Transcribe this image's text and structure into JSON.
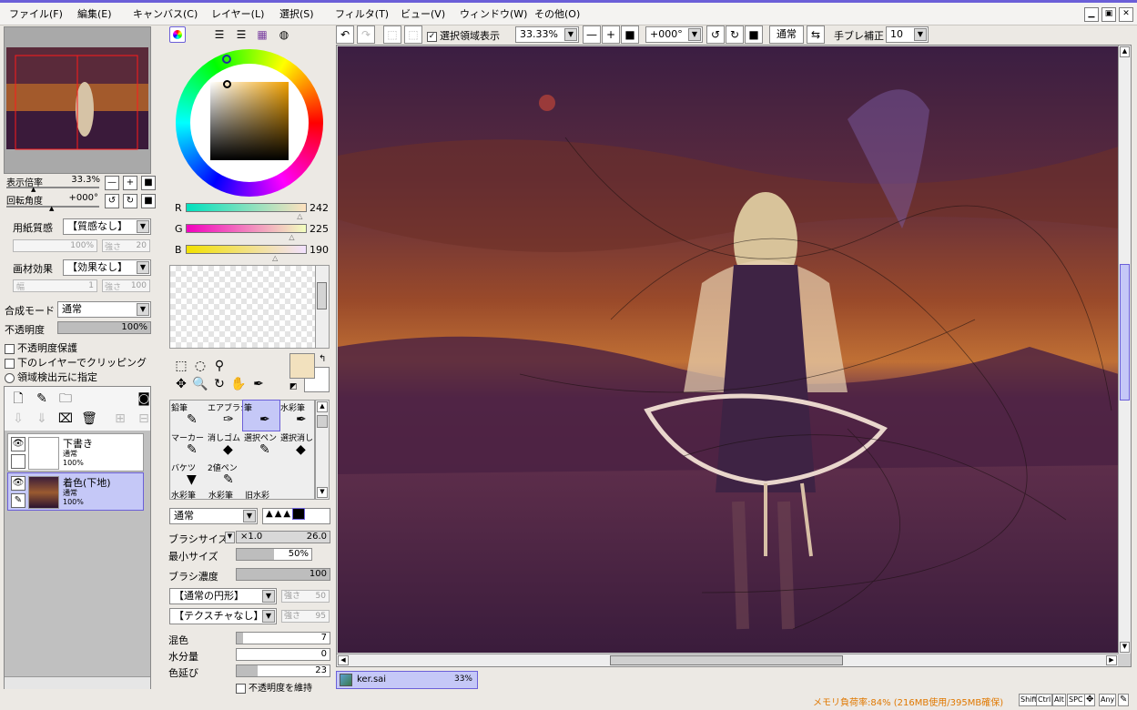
{
  "menu": [
    "ファイル(F)",
    "編集(E)",
    "キャンバス(C)",
    "レイヤー(L)",
    "選択(S)",
    "フィルタ(T)",
    "ビュー(V)",
    "ウィンドウ(W)",
    "その他(O)"
  ],
  "navigator": {
    "zoom_label": "表示倍率",
    "zoom_value": "33.3%",
    "rotate_label": "回転角度",
    "rotate_value": "+000°"
  },
  "paper": {
    "label": "用紙質感",
    "value": "【質感なし】",
    "scale_label": "倍率",
    "scale_value": "100%",
    "strength_label": "強さ",
    "strength_value": "20"
  },
  "effect": {
    "label": "画材効果",
    "value": "【効果なし】",
    "width_label": "幅",
    "width_value": "1",
    "strength_label": "強さ",
    "strength_value": "100"
  },
  "blend": {
    "label": "合成モード",
    "value": "通常"
  },
  "opacity": {
    "label": "不透明度",
    "value": "100%",
    "fraction": 1.0
  },
  "checks": {
    "preserve": "不透明度保護",
    "clip": "下のレイヤーでクリッピング",
    "detect": "領域検出元に指定"
  },
  "layers": [
    {
      "name": "下書き",
      "mode": "通常",
      "opacity": "100%",
      "selected": false
    },
    {
      "name": "着色(下地)",
      "mode": "通常",
      "opacity": "100%",
      "selected": true
    }
  ],
  "color": {
    "r": 242,
    "g": 225,
    "b": 190,
    "r_label": "R",
    "g_label": "G",
    "b_label": "B",
    "primary": "#f2e1be",
    "accent": "#6b5fd8"
  },
  "brushes": [
    {
      "name": "鉛筆",
      "icon": "pencil-icon",
      "glyph": "✎"
    },
    {
      "name": "エアブラシ",
      "icon": "airbrush-icon",
      "glyph": "✑"
    },
    {
      "name": "筆",
      "icon": "brush-icon",
      "glyph": "✒"
    },
    {
      "name": "水彩筆",
      "icon": "watercolor-icon",
      "glyph": "✒"
    },
    {
      "name": "マーカー",
      "icon": "marker-icon",
      "glyph": "✎"
    },
    {
      "name": "消しゴム",
      "icon": "eraser-icon",
      "glyph": "◆"
    },
    {
      "name": "選択ペン",
      "icon": "select-pen-icon",
      "glyph": "✎"
    },
    {
      "name": "選択消し",
      "icon": "select-erase-icon",
      "glyph": "◆"
    },
    {
      "name": "バケツ",
      "icon": "bucket-icon",
      "glyph": "▼"
    },
    {
      "name": "2値ペン",
      "icon": "binary-pen-icon",
      "glyph": "✎"
    },
    {
      "name": "",
      "icon": "",
      "glyph": ""
    },
    {
      "name": "",
      "icon": "",
      "glyph": ""
    }
  ],
  "brush_extra": [
    "水彩筆",
    "水彩筆",
    "旧水彩"
  ],
  "brush_settings": {
    "mode": "通常",
    "size_label": "ブラシサイズ",
    "size_mult": "×1.0",
    "size_value": "26.0",
    "min_label": "最小サイズ",
    "min_value": "50%",
    "min_fraction": 0.5,
    "density_label": "ブラシ濃度",
    "density_value": "100",
    "density_fraction": 1.0,
    "shape": "【通常の円形】",
    "shape_strength_label": "強さ",
    "shape_strength": "50",
    "texture": "【テクスチャなし】",
    "texture_strength_label": "強さ",
    "texture_strength": "95",
    "mix_label": "混色",
    "mix_value": "7",
    "mix_fraction": 0.07,
    "water_label": "水分量",
    "water_value": "0",
    "water_fraction": 0.0,
    "extend_label": "色延び",
    "extend_value": "23",
    "extend_fraction": 0.23,
    "keep_opacity": "不透明度を維持"
  },
  "toolbar": {
    "selection_show": "選択領域表示",
    "zoom": "33.33%",
    "angle": "+000°",
    "mode": "通常",
    "stabilizer_label": "手ブレ補正",
    "stabilizer_value": "10"
  },
  "file_tab": {
    "name": "ker.sai",
    "zoom": "33%"
  },
  "status": {
    "memory": "メモリ負荷率:84% (216MB使用/395MB確保)",
    "keys": [
      "Shift",
      "Ctrl",
      "Alt",
      "SPC",
      "✥",
      "Any",
      "✎"
    ]
  }
}
